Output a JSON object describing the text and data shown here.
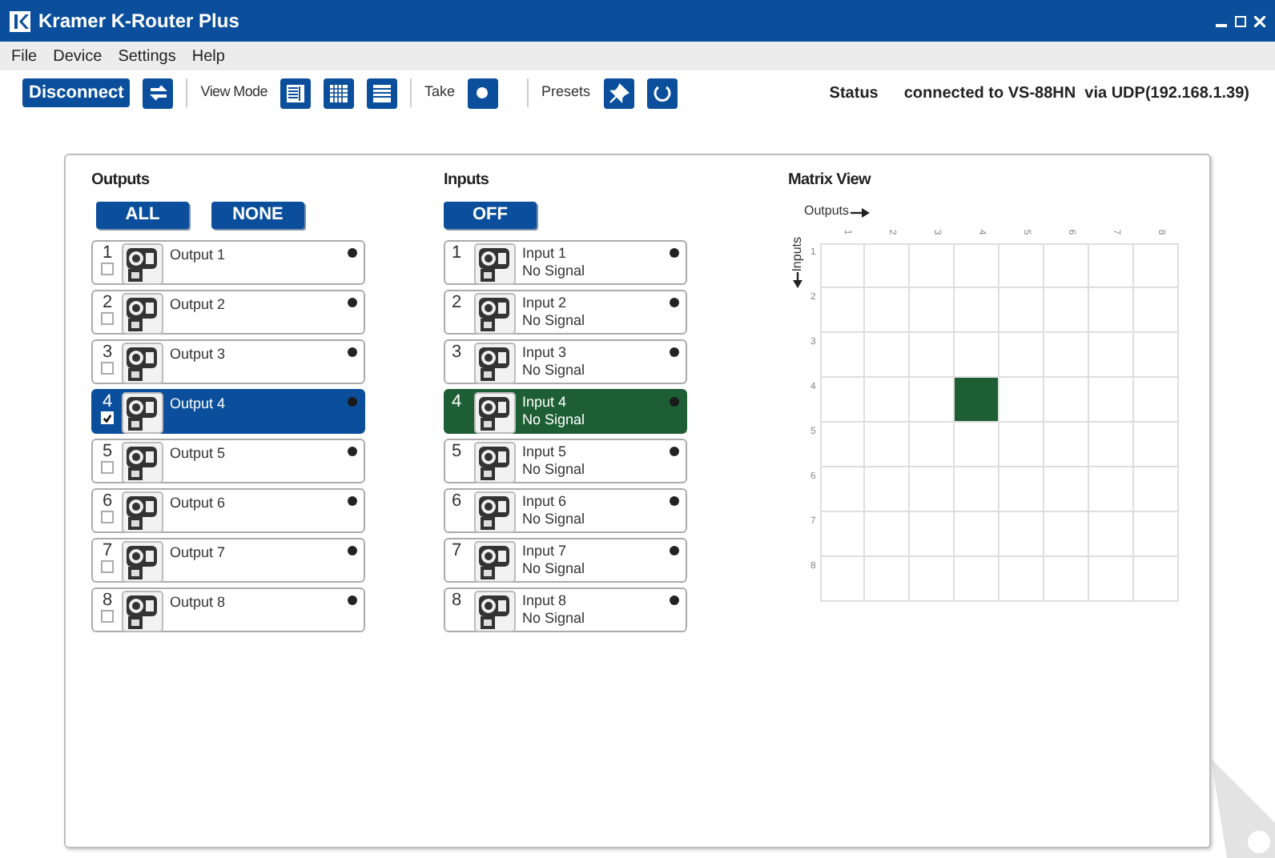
{
  "window": {
    "title": "Kramer K-Router Plus"
  },
  "menu": [
    "File",
    "Device",
    "Settings",
    "Help"
  ],
  "toolbar": {
    "disconnect": "Disconnect",
    "view_mode": "View Mode",
    "take": "Take",
    "presets": "Presets",
    "status_label": "Status",
    "status_text": "connected to VS-88HN  via UDP(192.168.1.39)"
  },
  "outputs": {
    "title": "Outputs",
    "buttons": [
      "ALL",
      "NONE"
    ],
    "items": [
      {
        "number": "1",
        "name": "Output 1",
        "checked": false,
        "selected": false
      },
      {
        "number": "2",
        "name": "Output 2",
        "checked": false,
        "selected": false
      },
      {
        "number": "3",
        "name": "Output 3",
        "checked": false,
        "selected": false
      },
      {
        "number": "4",
        "name": "Output 4",
        "checked": true,
        "selected": true
      },
      {
        "number": "5",
        "name": "Output 5",
        "checked": false,
        "selected": false
      },
      {
        "number": "6",
        "name": "Output 6",
        "checked": false,
        "selected": false
      },
      {
        "number": "7",
        "name": "Output 7",
        "checked": false,
        "selected": false
      },
      {
        "number": "8",
        "name": "Output 8",
        "checked": false,
        "selected": false
      }
    ]
  },
  "inputs": {
    "title": "Inputs",
    "buttons": [
      "OFF"
    ],
    "items": [
      {
        "number": "1",
        "name": "Input 1",
        "status": "No Signal",
        "selected": false
      },
      {
        "number": "2",
        "name": "Input 2",
        "status": "No Signal",
        "selected": false
      },
      {
        "number": "3",
        "name": "Input 3",
        "status": "No Signal",
        "selected": false
      },
      {
        "number": "4",
        "name": "Input 4",
        "status": "No Signal",
        "selected": true
      },
      {
        "number": "5",
        "name": "Input 5",
        "status": "No Signal",
        "selected": false
      },
      {
        "number": "6",
        "name": "Input 6",
        "status": "No Signal",
        "selected": false
      },
      {
        "number": "7",
        "name": "Input 7",
        "status": "No Signal",
        "selected": false
      },
      {
        "number": "8",
        "name": "Input 8",
        "status": "No Signal",
        "selected": false
      }
    ]
  },
  "matrix": {
    "title": "Matrix View",
    "outputs_label": "Outputs",
    "inputs_label": "Inputs",
    "column_labels": [
      "1",
      "2",
      "3",
      "4",
      "5",
      "6",
      "7",
      "8"
    ],
    "rows": [
      {
        "label": "1",
        "cells": [
          {
            "on": false
          },
          {
            "on": false
          },
          {
            "on": false
          },
          {
            "on": false
          },
          {
            "on": false
          },
          {
            "on": false
          },
          {
            "on": false
          },
          {
            "on": false
          }
        ]
      },
      {
        "label": "2",
        "cells": [
          {
            "on": false
          },
          {
            "on": false
          },
          {
            "on": false
          },
          {
            "on": false
          },
          {
            "on": false
          },
          {
            "on": false
          },
          {
            "on": false
          },
          {
            "on": false
          }
        ]
      },
      {
        "label": "3",
        "cells": [
          {
            "on": false
          },
          {
            "on": false
          },
          {
            "on": false
          },
          {
            "on": false
          },
          {
            "on": false
          },
          {
            "on": false
          },
          {
            "on": false
          },
          {
            "on": false
          }
        ]
      },
      {
        "label": "4",
        "cells": [
          {
            "on": false
          },
          {
            "on": false
          },
          {
            "on": false
          },
          {
            "on": true
          },
          {
            "on": false
          },
          {
            "on": false
          },
          {
            "on": false
          },
          {
            "on": false
          }
        ]
      },
      {
        "label": "5",
        "cells": [
          {
            "on": false
          },
          {
            "on": false
          },
          {
            "on": false
          },
          {
            "on": false
          },
          {
            "on": false
          },
          {
            "on": false
          },
          {
            "on": false
          },
          {
            "on": false
          }
        ]
      },
      {
        "label": "6",
        "cells": [
          {
            "on": false
          },
          {
            "on": false
          },
          {
            "on": false
          },
          {
            "on": false
          },
          {
            "on": false
          },
          {
            "on": false
          },
          {
            "on": false
          },
          {
            "on": false
          }
        ]
      },
      {
        "label": "7",
        "cells": [
          {
            "on": false
          },
          {
            "on": false
          },
          {
            "on": false
          },
          {
            "on": false
          },
          {
            "on": false
          },
          {
            "on": false
          },
          {
            "on": false
          },
          {
            "on": false
          }
        ]
      },
      {
        "label": "8",
        "cells": [
          {
            "on": false
          },
          {
            "on": false
          },
          {
            "on": false
          },
          {
            "on": false
          },
          {
            "on": false
          },
          {
            "on": false
          },
          {
            "on": false
          },
          {
            "on": false
          }
        ]
      }
    ]
  }
}
